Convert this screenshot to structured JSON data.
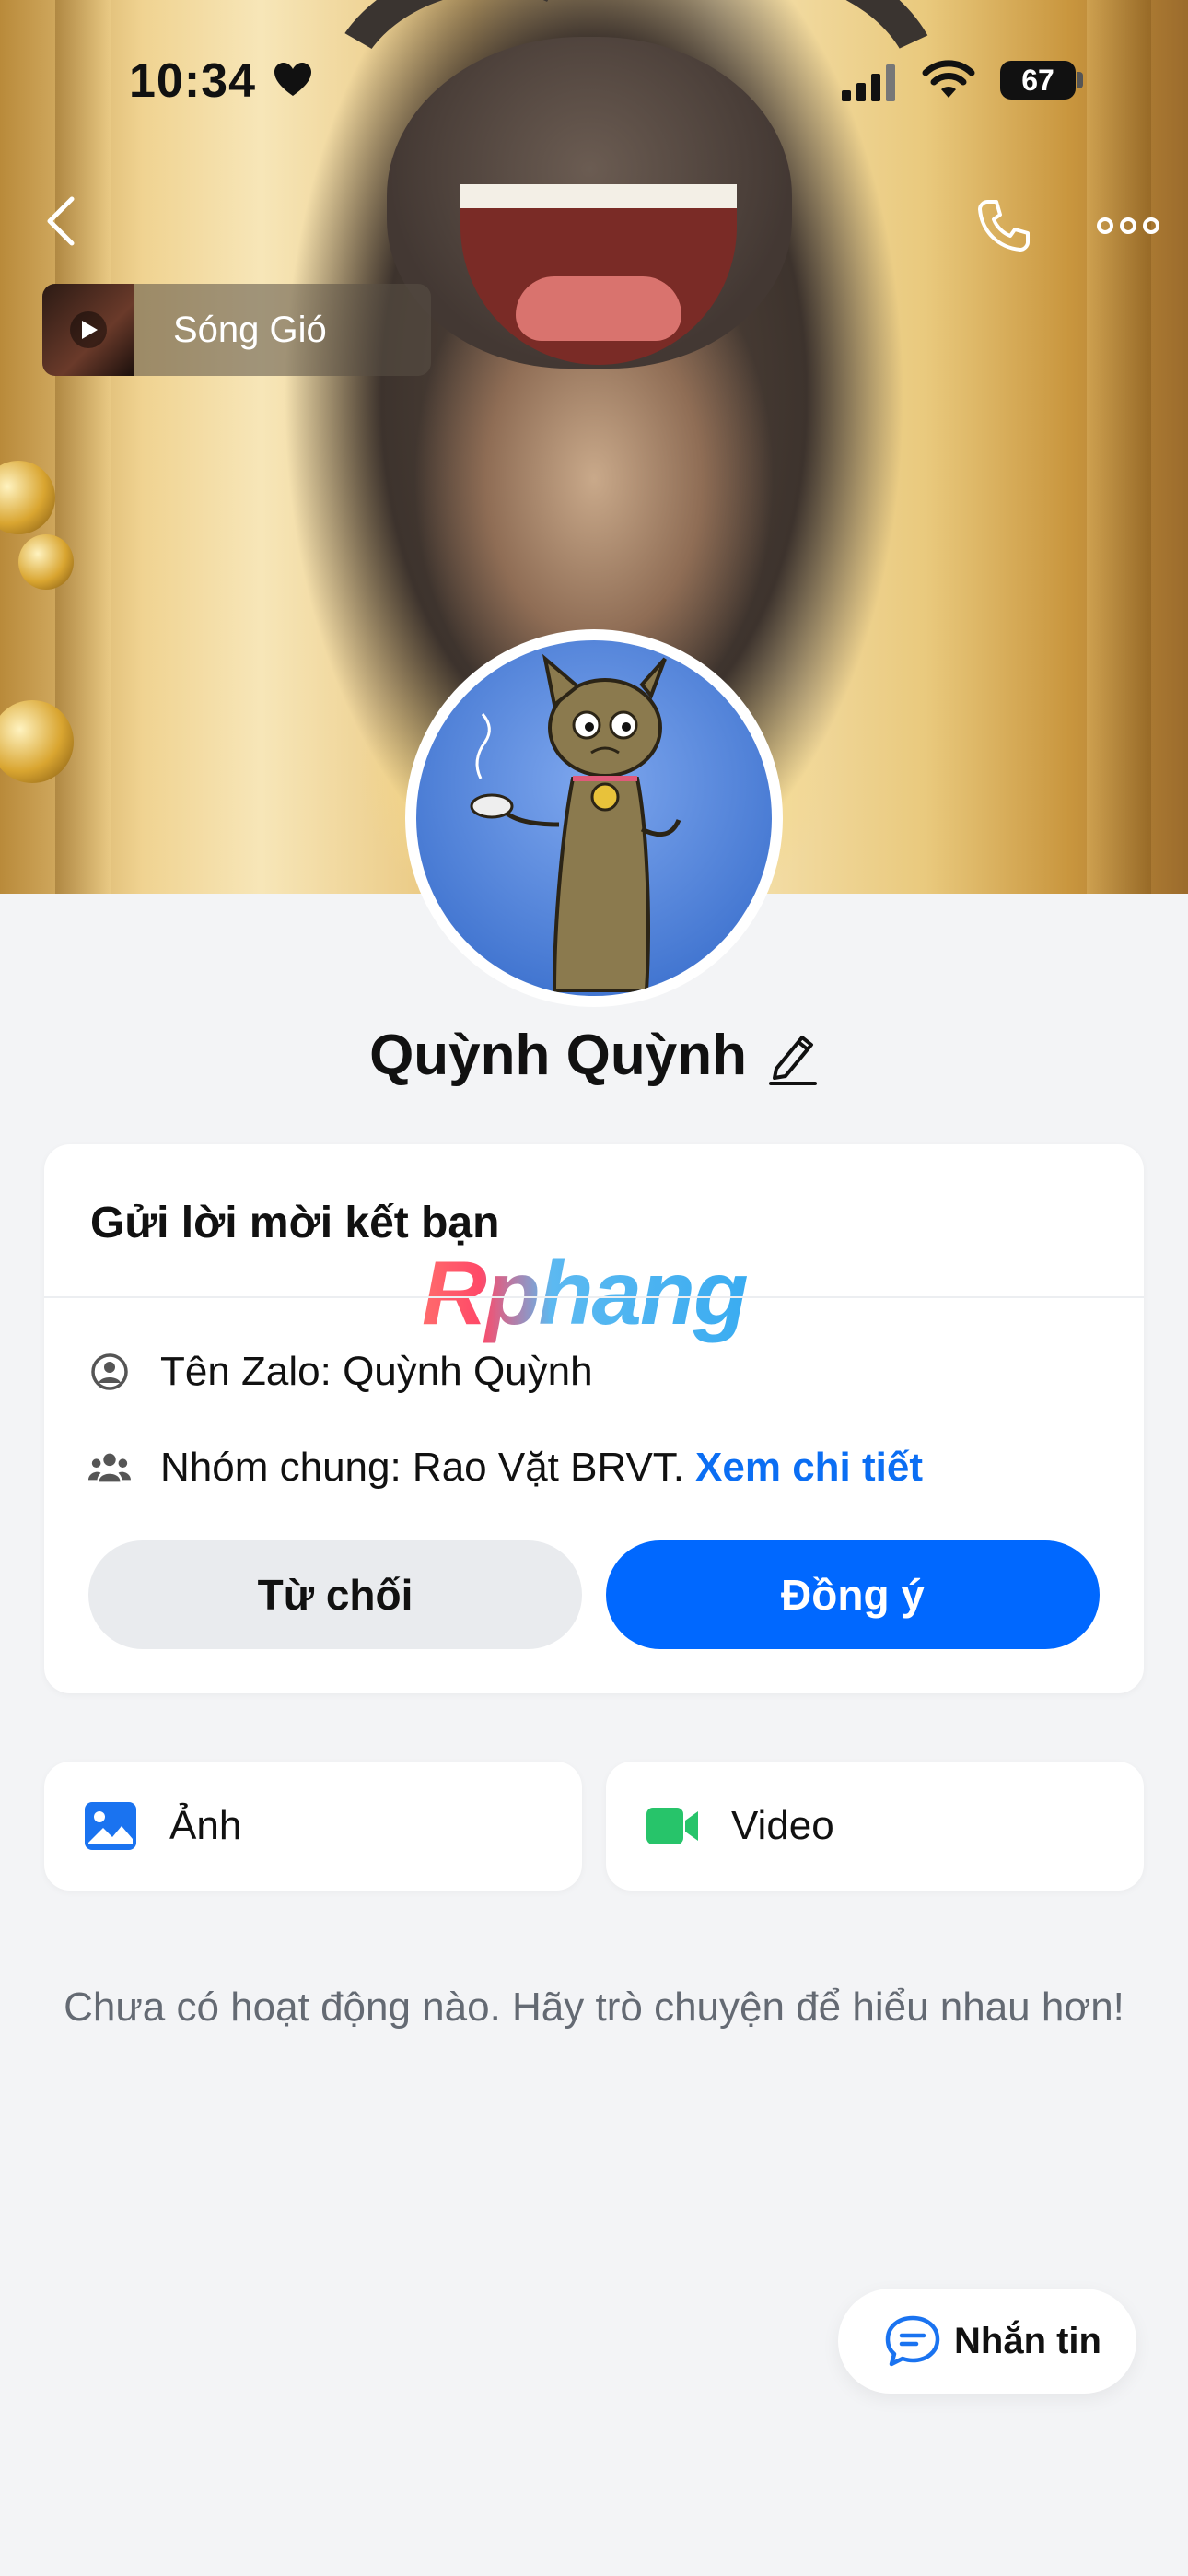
{
  "status_bar": {
    "time": "10:34",
    "battery": "67"
  },
  "header": {
    "music_title": "Sóng Gió"
  },
  "profile": {
    "name": "Quỳnh Quỳnh"
  },
  "friend_request": {
    "title": "Gửi lời mời kết bạn",
    "watermark": "Rphang",
    "zalo_name_label": "Tên Zalo: Quỳnh Quỳnh",
    "common_group_label": "Nhóm chung: Rao Vặt BRVT.",
    "details_link": "Xem chi tiết",
    "decline_label": "Từ chối",
    "accept_label": "Đồng ý"
  },
  "media": {
    "photo_label": "Ảnh",
    "video_label": "Video"
  },
  "empty_state": "Chưa có hoạt động nào. Hãy trò chuyện để hiểu nhau hơn!",
  "message_button": {
    "label": "Nhắn tin"
  },
  "colors": {
    "accent": "#0068ff",
    "link": "#0b6ef3",
    "video_icon": "#27c46a",
    "background": "#f3f4f6"
  }
}
